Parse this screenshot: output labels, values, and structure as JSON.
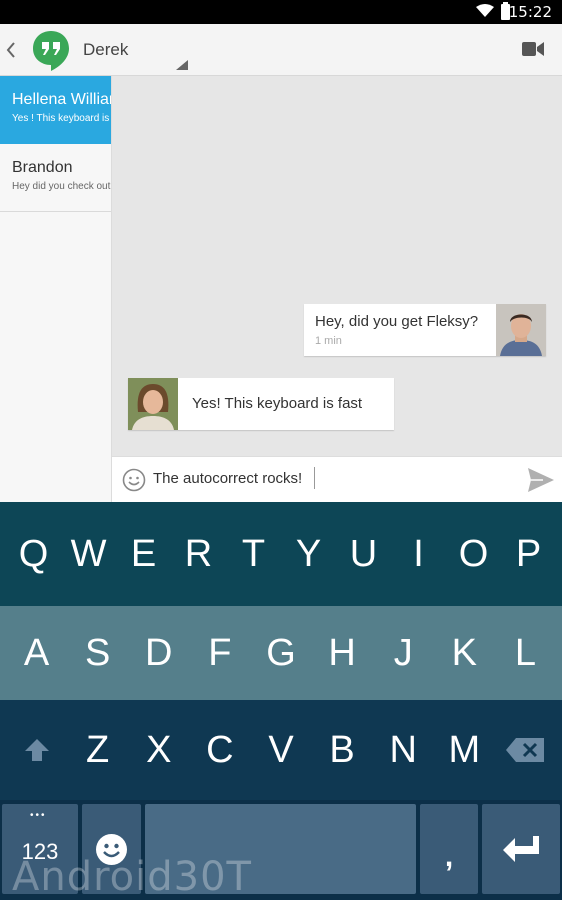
{
  "status_bar": {
    "time": "15:22",
    "icons": [
      "wifi-icon",
      "battery-icon"
    ]
  },
  "header": {
    "contact_name": "Derek",
    "icons": [
      "back-icon",
      "hangouts-logo",
      "video-call-icon"
    ]
  },
  "sidebar": {
    "conversations": [
      {
        "name": "Hellena Williams",
        "preview": "Yes ! This keyboard is fast",
        "active": true
      },
      {
        "name": "Brandon",
        "preview": "Hey did you check out",
        "active": false
      }
    ]
  },
  "chat": {
    "messages": [
      {
        "direction": "outgoing",
        "text": "Hey, did you get Fleksy?",
        "time": "1 min"
      },
      {
        "direction": "incoming",
        "text": "Yes! This keyboard is fast"
      }
    ]
  },
  "compose": {
    "value": "The autocorrect rocks!",
    "icons": [
      "emoji-icon",
      "send-icon"
    ]
  },
  "keyboard": {
    "row1": [
      "Q",
      "W",
      "E",
      "R",
      "T",
      "Y",
      "U",
      "I",
      "O",
      "P"
    ],
    "row2": [
      "A",
      "S",
      "D",
      "F",
      "G",
      "H",
      "J",
      "K",
      "L"
    ],
    "row3": [
      "Z",
      "X",
      "C",
      "V",
      "B",
      "N",
      "M"
    ],
    "numbers_label": "123",
    "more_indicator": "•••",
    "comma_label": ",",
    "watermark": "Android30T",
    "colors": {
      "row1": "#0d4656",
      "row2": "#557f8b",
      "row3": "#0f3852",
      "row4": "#0c2f48"
    }
  },
  "colors": {
    "accent": "#2aa8e0",
    "hangouts_green": "#3aa757"
  }
}
